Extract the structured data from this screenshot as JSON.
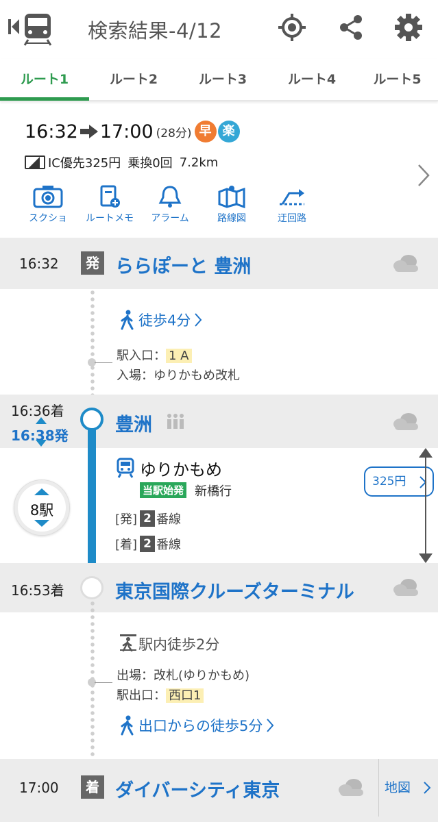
{
  "header": {
    "title": "検索結果-4/12"
  },
  "tabs": [
    {
      "label": "ルート1",
      "active": true
    },
    {
      "label": "ルート2",
      "active": false
    },
    {
      "label": "ルート3",
      "active": false
    },
    {
      "label": "ルート4",
      "active": false
    },
    {
      "label": "ルート5",
      "active": false
    }
  ],
  "summary": {
    "dep_time": "16:32",
    "arr_time": "17:00",
    "duration": "(28分)",
    "badge_fast": "早",
    "badge_easy": "楽",
    "ic_fare": "IC優先325円",
    "transfers": "乗換0回",
    "distance": "7.2km",
    "actions": [
      "スクショ",
      "ルートメモ",
      "アラーム",
      "路線図",
      "迂回路"
    ]
  },
  "stations": {
    "origin": {
      "time": "16:32",
      "tag": "発",
      "name": "ららぽーと 豊洲"
    },
    "board": {
      "arr": "16:36着",
      "dep": "16:38発",
      "name": "豊洲"
    },
    "alight": {
      "time": "16:53着",
      "name": "東京国際クルーズターミナル"
    },
    "dest": {
      "time": "17:00",
      "tag": "着",
      "name": "ダイバーシティ東京",
      "map": "地図"
    }
  },
  "walk1": {
    "label": "徒歩4分",
    "entrance_label": "駅入口：",
    "entrance_value": "1 A",
    "gate": "入場：ゆりかもめ改札"
  },
  "ride": {
    "line": "ゆりかもめ",
    "origin_tag": "当駅始発",
    "for": "新橋行",
    "dep_track_tag": "[発]",
    "dep_track_num": "2",
    "dep_track_suffix": "番線",
    "arr_track_tag": "[着]",
    "arr_track_num": "2",
    "arr_track_suffix": "番線",
    "stops": "8駅",
    "fare": "325円"
  },
  "walk2": {
    "inner": "駅内徒歩2分",
    "exit_gate": "出場：改札(ゆりかもめ)",
    "exit_label": "駅出口：",
    "exit_value": "西口1",
    "walk_from_exit": "出口からの徒歩5分"
  },
  "colors": {
    "accent_green": "#2e9b4f",
    "link_blue": "#1e73c8",
    "line_blue": "#1e8bc8",
    "fast_badge": "#f07c32",
    "easy_badge": "#34a7d6"
  }
}
